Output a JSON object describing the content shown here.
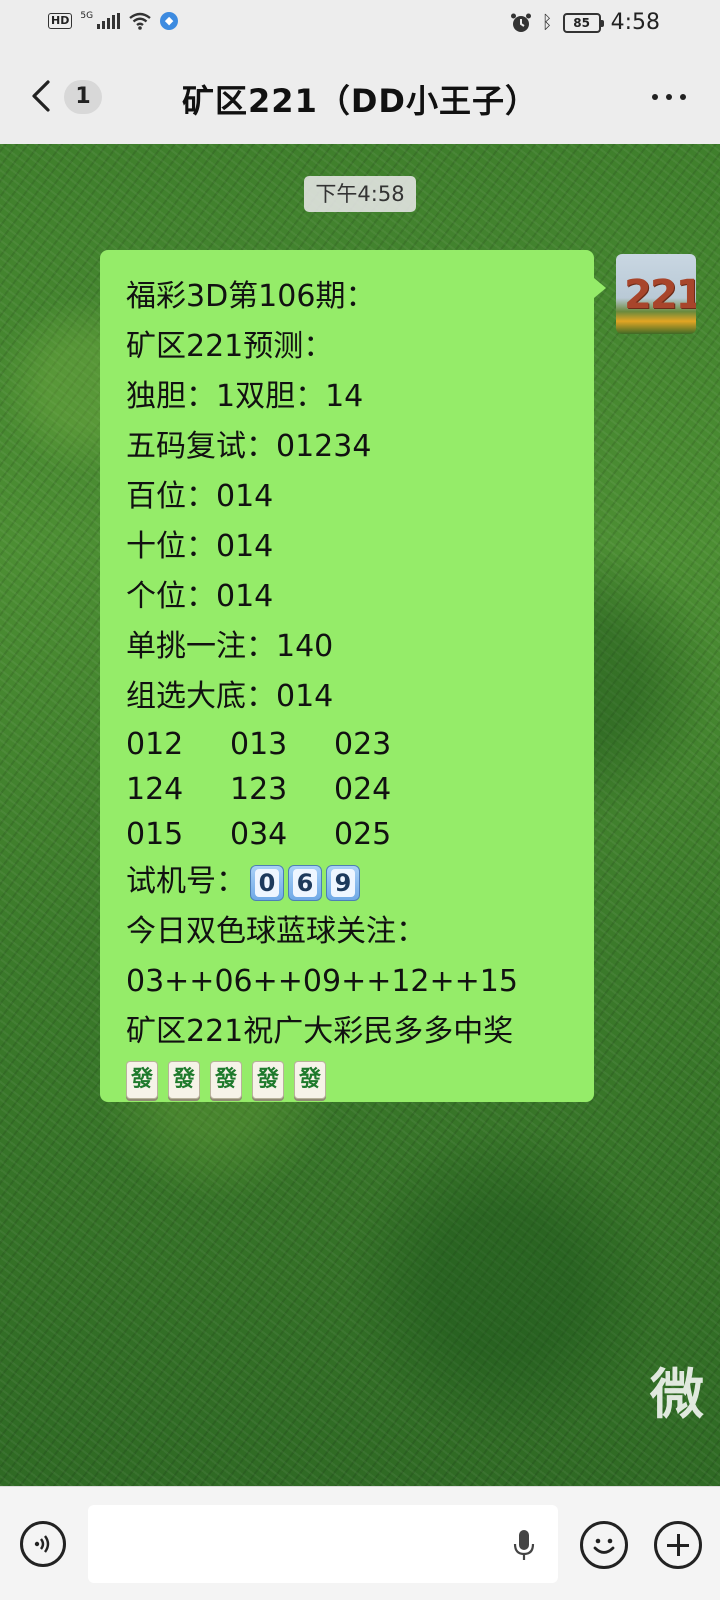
{
  "status_bar": {
    "hd_label": "HD",
    "network_label": "5G",
    "battery": "85",
    "time": "4:58"
  },
  "header": {
    "unread_count": "1",
    "title": "矿区221（DD小王子）"
  },
  "chat": {
    "timestamp": "下午4:58",
    "avatar_text": "221",
    "message": {
      "line1": "福彩3D第106期：",
      "line2": "矿区221预测：",
      "line3": "独胆：1双胆：14",
      "line4": "五码复试：01234",
      "line5": "百位：014",
      "line6": "十位：014",
      "line7": "个位：014",
      "line8": "单挑一注：140",
      "line9": "组选大底：014",
      "combos": [
        [
          "012",
          "013",
          "023"
        ],
        [
          "124",
          "123",
          "024"
        ],
        [
          "015",
          "034",
          "025"
        ]
      ],
      "trial_label": "试机号：",
      "trial_digits": [
        "0",
        "6",
        "9"
      ],
      "blue_ball_label": "今日双色球蓝球关注：",
      "blue_ball_numbers": "03++06++09++12++15",
      "wishes": "矿区221祝广大彩民多多中奖",
      "tiles": [
        "發",
        "發",
        "發",
        "發",
        "發"
      ]
    },
    "watermark": "微"
  },
  "colors": {
    "bubble": "#95ec69",
    "header_bg": "#ededed",
    "input_bg": "#f4f4f4"
  },
  "icons": [
    "back-icon",
    "more-icon",
    "voice-icon",
    "mic-icon",
    "emoji-icon",
    "add-icon",
    "alarm-icon",
    "bluetooth-icon",
    "wifi-icon"
  ]
}
